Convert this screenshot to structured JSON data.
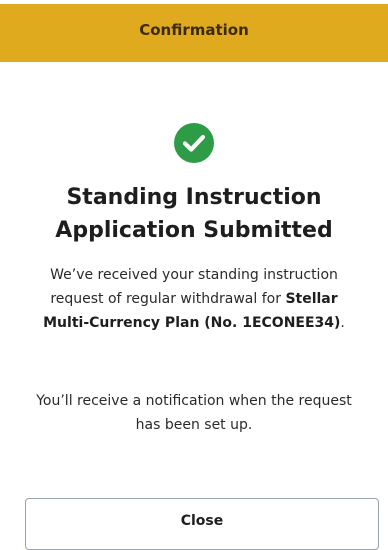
{
  "header": {
    "title": "Confirmation",
    "background_color": "#e0aa1f"
  },
  "status": {
    "icon": "check-circle-icon",
    "icon_color": "#2e9b46",
    "headline_line1": "Standing Instruction",
    "headline_line2": "Application Submitted"
  },
  "message": {
    "text_before": "We’ve received your standing instruction request of regular withdrawal for ",
    "plan": "Stellar Multi-Currency Plan (No. 1ECONEE34)",
    "text_after": "."
  },
  "notice": {
    "text": "You’ll receive a notification when the request has been set up."
  },
  "actions": {
    "close_label": "Close"
  }
}
